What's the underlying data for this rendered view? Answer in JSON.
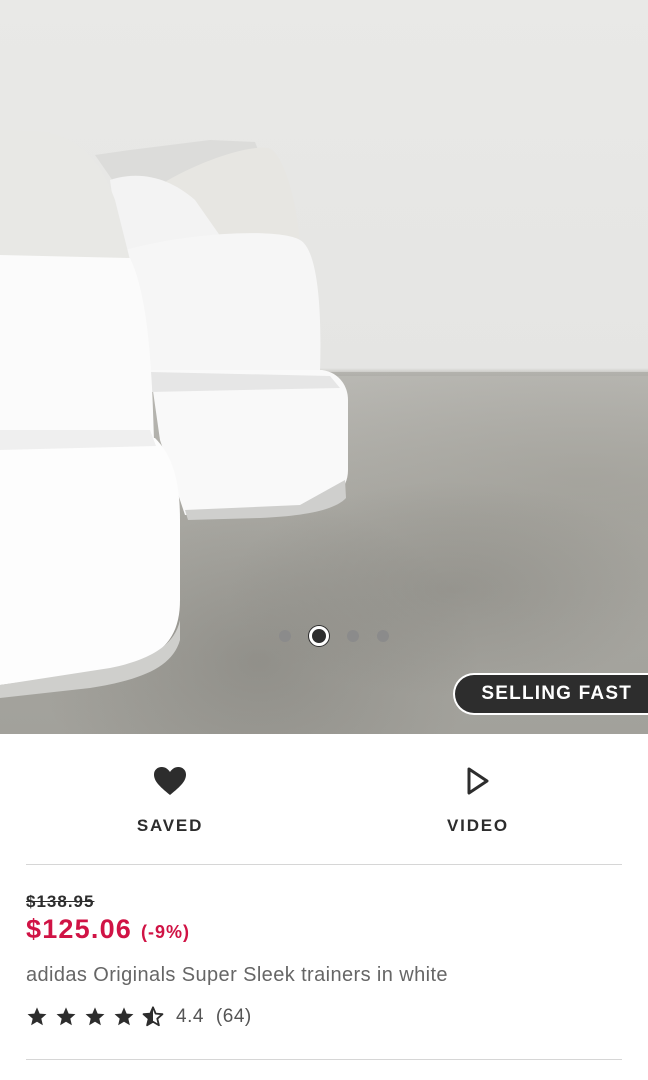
{
  "gallery": {
    "image_alt": "adidas Originals Super Sleek trainers in white",
    "page_count": 4,
    "active_index": 1,
    "badge": "SELLING FAST"
  },
  "actions": {
    "saved": {
      "label": "SAVED",
      "icon": "heart-filled-icon"
    },
    "video": {
      "label": "VIDEO",
      "icon": "play-outline-icon"
    }
  },
  "product": {
    "original_price": "$138.95",
    "sale_price": "$125.06",
    "discount": "(-9%)",
    "title": "adidas Originals Super Sleek trainers in white",
    "rating": {
      "value": "4.4",
      "count": "(64)",
      "stars": 4.4
    }
  },
  "colors": {
    "sale": "#d01345",
    "text": "#2d2d2d",
    "muted": "#666666",
    "badge_bg": "#2d2d2d"
  }
}
